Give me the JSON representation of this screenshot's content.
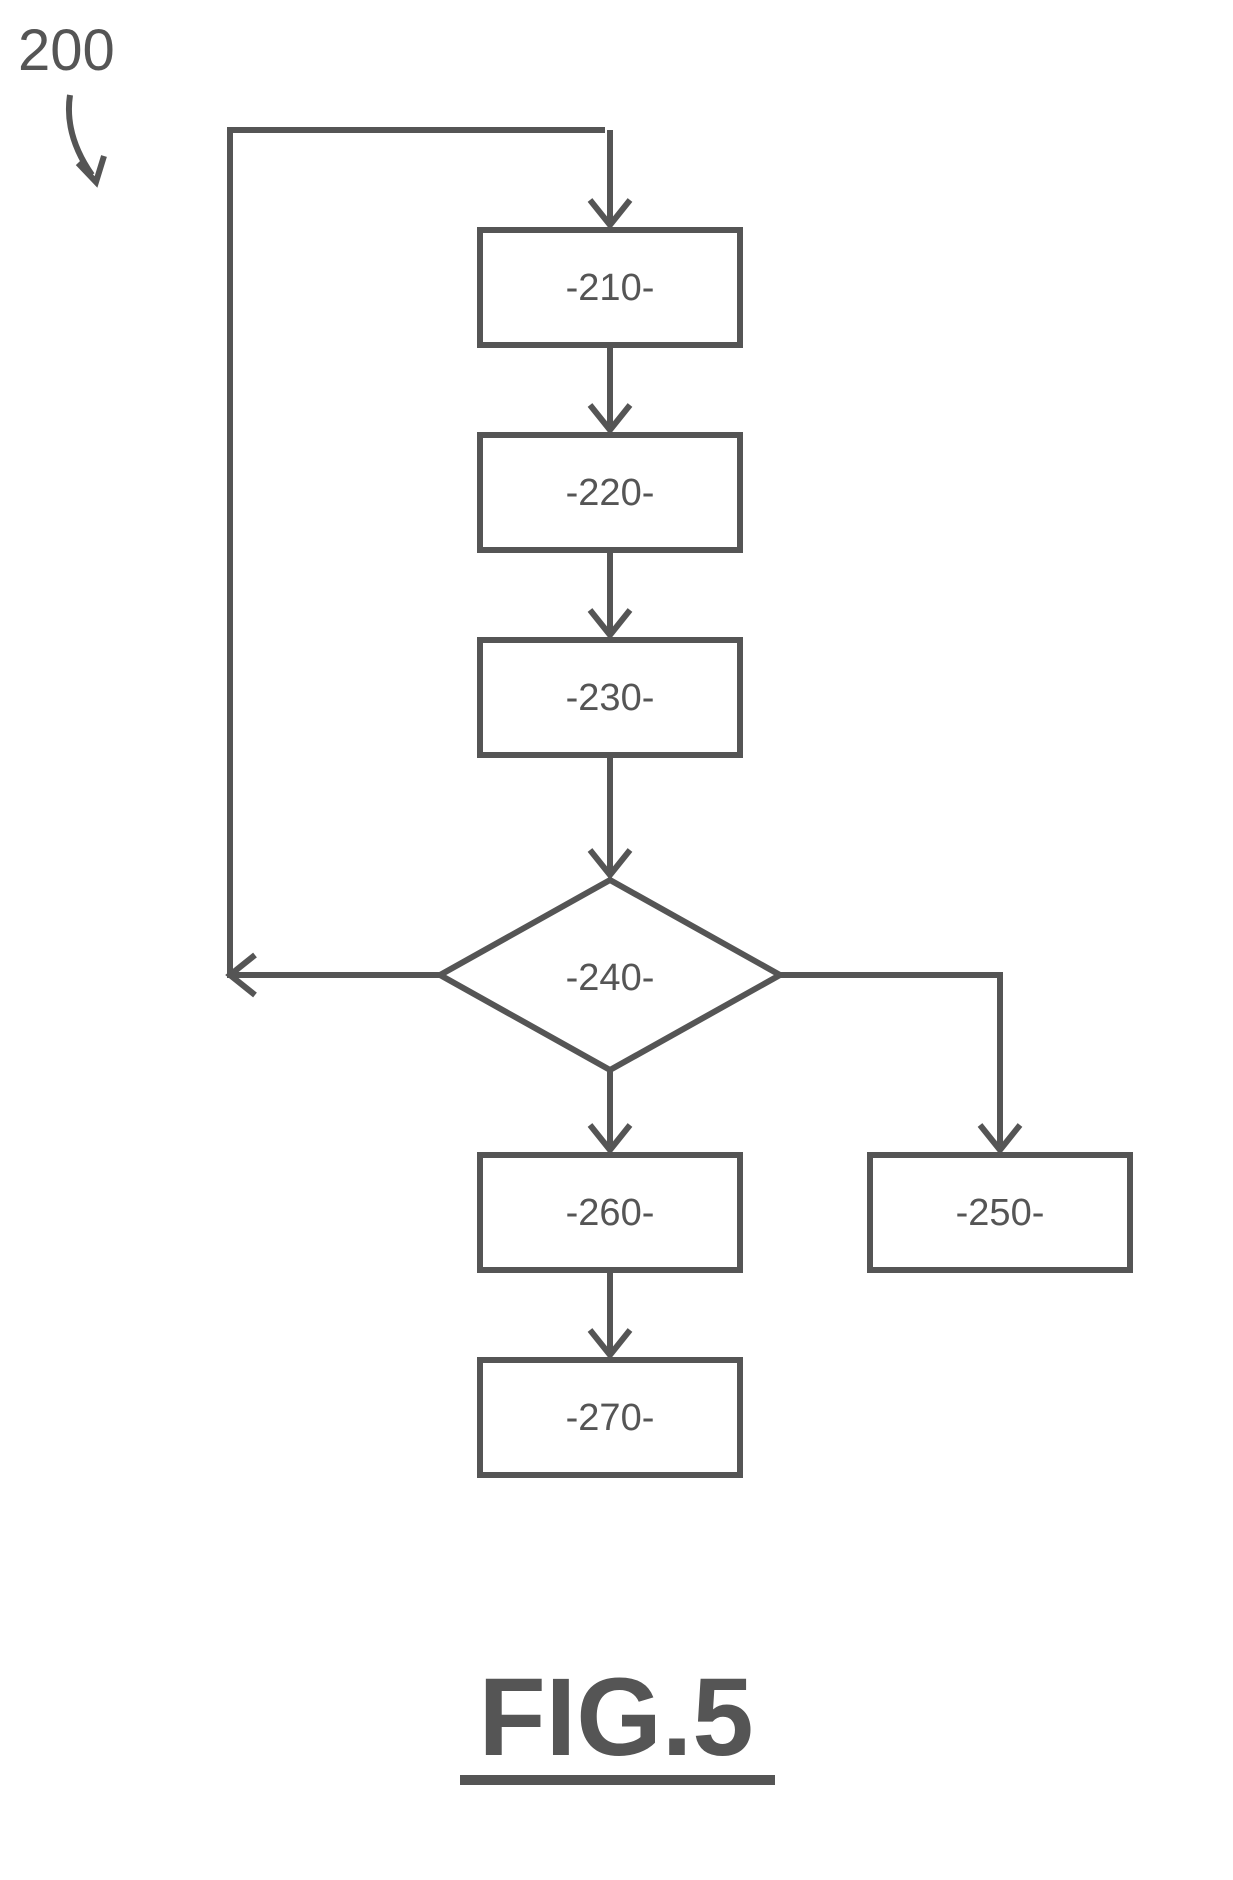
{
  "diagram": {
    "annotation_number": "200",
    "figure_label": "FIG.5",
    "boxes": {
      "b210": "-210-",
      "b220": "-220-",
      "b230": "-230-",
      "b240": "-240-",
      "b250": "-250-",
      "b260": "-260-",
      "b270": "-270-"
    },
    "edges": [
      {
        "from": "entry",
        "to": "b210"
      },
      {
        "from": "b210",
        "to": "b220"
      },
      {
        "from": "b220",
        "to": "b230"
      },
      {
        "from": "b230",
        "to": "b240"
      },
      {
        "from": "b240",
        "to": "b260"
      },
      {
        "from": "b240",
        "to": "b250"
      },
      {
        "from": "b240",
        "to": "entry",
        "note": "loop-back (left)"
      },
      {
        "from": "b260",
        "to": "b270"
      }
    ]
  }
}
